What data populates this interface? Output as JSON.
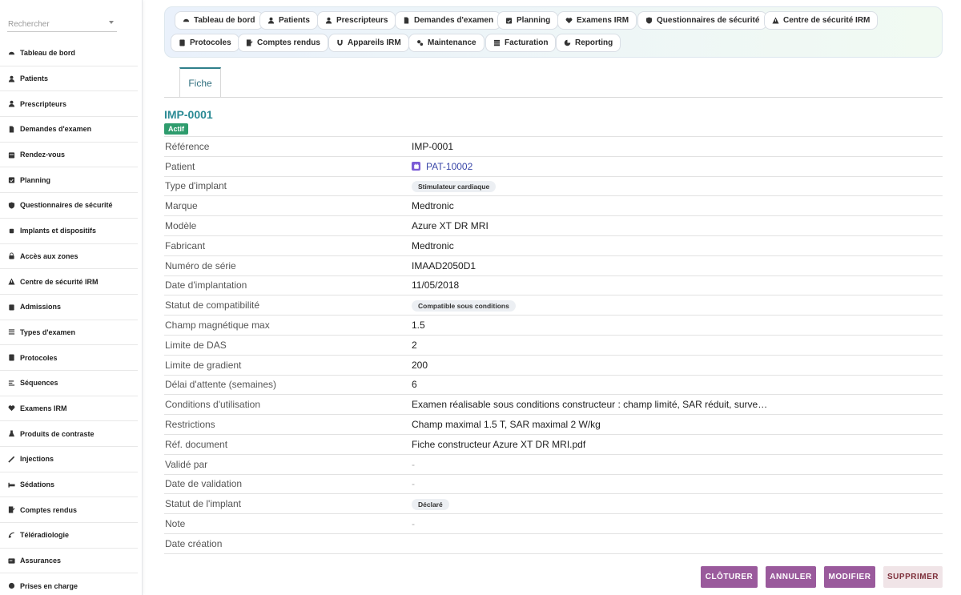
{
  "search": {
    "placeholder": "Rechercher"
  },
  "sidebar": {
    "items": [
      {
        "label": "Tableau de bord",
        "icon": "dashboard-icon"
      },
      {
        "label": "Patients",
        "icon": "user-icon"
      },
      {
        "label": "Prescripteurs",
        "icon": "user-doctor-icon"
      },
      {
        "label": "Demandes d'examen",
        "icon": "document-icon"
      },
      {
        "label": "Rendez-vous",
        "icon": "calendar-icon"
      },
      {
        "label": "Planning",
        "icon": "calendar-check-icon"
      },
      {
        "label": "Questionnaires de sécurité",
        "icon": "shield-icon"
      },
      {
        "label": "Implants et dispositifs",
        "icon": "microchip-icon"
      },
      {
        "label": "Accès aux zones",
        "icon": "lock-icon"
      },
      {
        "label": "Centre de sécurité IRM",
        "icon": "warning-icon"
      },
      {
        "label": "Admissions",
        "icon": "clipboard-icon"
      },
      {
        "label": "Types d'examen",
        "icon": "list-icon"
      },
      {
        "label": "Protocoles",
        "icon": "file-list-icon"
      },
      {
        "label": "Séquences",
        "icon": "sequence-icon"
      },
      {
        "label": "Examens IRM",
        "icon": "heartbeat-icon"
      },
      {
        "label": "Produits de contraste",
        "icon": "flask-icon"
      },
      {
        "label": "Injections",
        "icon": "syringe-icon"
      },
      {
        "label": "Sédations",
        "icon": "bed-icon"
      },
      {
        "label": "Comptes rendus",
        "icon": "report-icon"
      },
      {
        "label": "Téléradiologie",
        "icon": "satellite-icon"
      },
      {
        "label": "Assurances",
        "icon": "card-icon"
      },
      {
        "label": "Prises en charge",
        "icon": "circle-icon"
      }
    ]
  },
  "topmenu": {
    "row1": [
      {
        "label": "Tableau de bord",
        "icon": "dashboard-icon"
      },
      {
        "label": "Patients",
        "icon": "user-icon"
      },
      {
        "label": "Prescripteurs",
        "icon": "user-doctor-icon"
      },
      {
        "label": "Demandes d'examen",
        "icon": "document-icon"
      },
      {
        "label": "Planning",
        "icon": "calendar-check-icon"
      },
      {
        "label": "Examens IRM",
        "icon": "heartbeat-icon"
      },
      {
        "label": "Questionnaires de sécurité",
        "icon": "shield-icon"
      },
      {
        "label": "Centre de sécurité IRM",
        "icon": "warning-icon"
      }
    ],
    "row2": [
      {
        "label": "Protocoles",
        "icon": "file-list-icon"
      },
      {
        "label": "Comptes rendus",
        "icon": "report-icon"
      },
      {
        "label": "Appareils IRM",
        "icon": "magnet-icon"
      },
      {
        "label": "Maintenance",
        "icon": "gears-icon"
      },
      {
        "label": "Facturation",
        "icon": "billing-icon"
      },
      {
        "label": "Reporting",
        "icon": "chart-pie-icon"
      }
    ]
  },
  "tabs": {
    "active": "Fiche"
  },
  "record": {
    "title": "IMP-0001",
    "status_badge": "Actif",
    "fields": [
      {
        "label": "Référence",
        "value": "IMP-0001",
        "kind": "text"
      },
      {
        "label": "Patient",
        "value": "PAT-10002",
        "kind": "link"
      },
      {
        "label": "Type d'implant",
        "value": "Stimulateur cardiaque",
        "kind": "chip"
      },
      {
        "label": "Marque",
        "value": "Medtronic",
        "kind": "text"
      },
      {
        "label": "Modèle",
        "value": "Azure XT DR MRI",
        "kind": "text"
      },
      {
        "label": "Fabricant",
        "value": "Medtronic",
        "kind": "text"
      },
      {
        "label": "Numéro de série",
        "value": "IMAAD2050D1",
        "kind": "text"
      },
      {
        "label": "Date d'implantation",
        "value": "11/05/2018",
        "kind": "text"
      },
      {
        "label": "Statut de compatibilité",
        "value": "Compatible sous conditions",
        "kind": "chip"
      },
      {
        "label": "Champ magnétique max",
        "value": "1.5",
        "kind": "text"
      },
      {
        "label": "Limite de DAS",
        "value": "2",
        "kind": "text"
      },
      {
        "label": "Limite de gradient",
        "value": "200",
        "kind": "text"
      },
      {
        "label": "Délai d'attente (semaines)",
        "value": "6",
        "kind": "text"
      },
      {
        "label": "Conditions d'utilisation",
        "value": "Examen réalisable sous conditions constructeur : champ limité, SAR réduit, surve…",
        "kind": "text"
      },
      {
        "label": "Restrictions",
        "value": "Champ maximal 1.5 T, SAR maximal 2 W/kg",
        "kind": "text"
      },
      {
        "label": "Réf. document",
        "value": "Fiche constructeur Azure XT DR MRI.pdf",
        "kind": "text"
      },
      {
        "label": "Validé par",
        "value": "-",
        "kind": "dash"
      },
      {
        "label": "Date de validation",
        "value": "-",
        "kind": "dash"
      },
      {
        "label": "Statut de l'implant",
        "value": "Déclaré",
        "kind": "chip"
      },
      {
        "label": "Note",
        "value": "-",
        "kind": "dash"
      },
      {
        "label": "Date création",
        "value": "",
        "kind": "text"
      }
    ]
  },
  "actions": {
    "close": "CLÔTURER",
    "cancel": "ANNULER",
    "edit": "MODIFIER",
    "delete": "SUPPRIMER"
  },
  "colors": {
    "accent_teal": "#2a8a94",
    "active_badge": "#2e9c6d",
    "action_purple": "#9a5a9c",
    "delete_bg": "#f0e4e7",
    "patient_link": "#3a47a8"
  }
}
